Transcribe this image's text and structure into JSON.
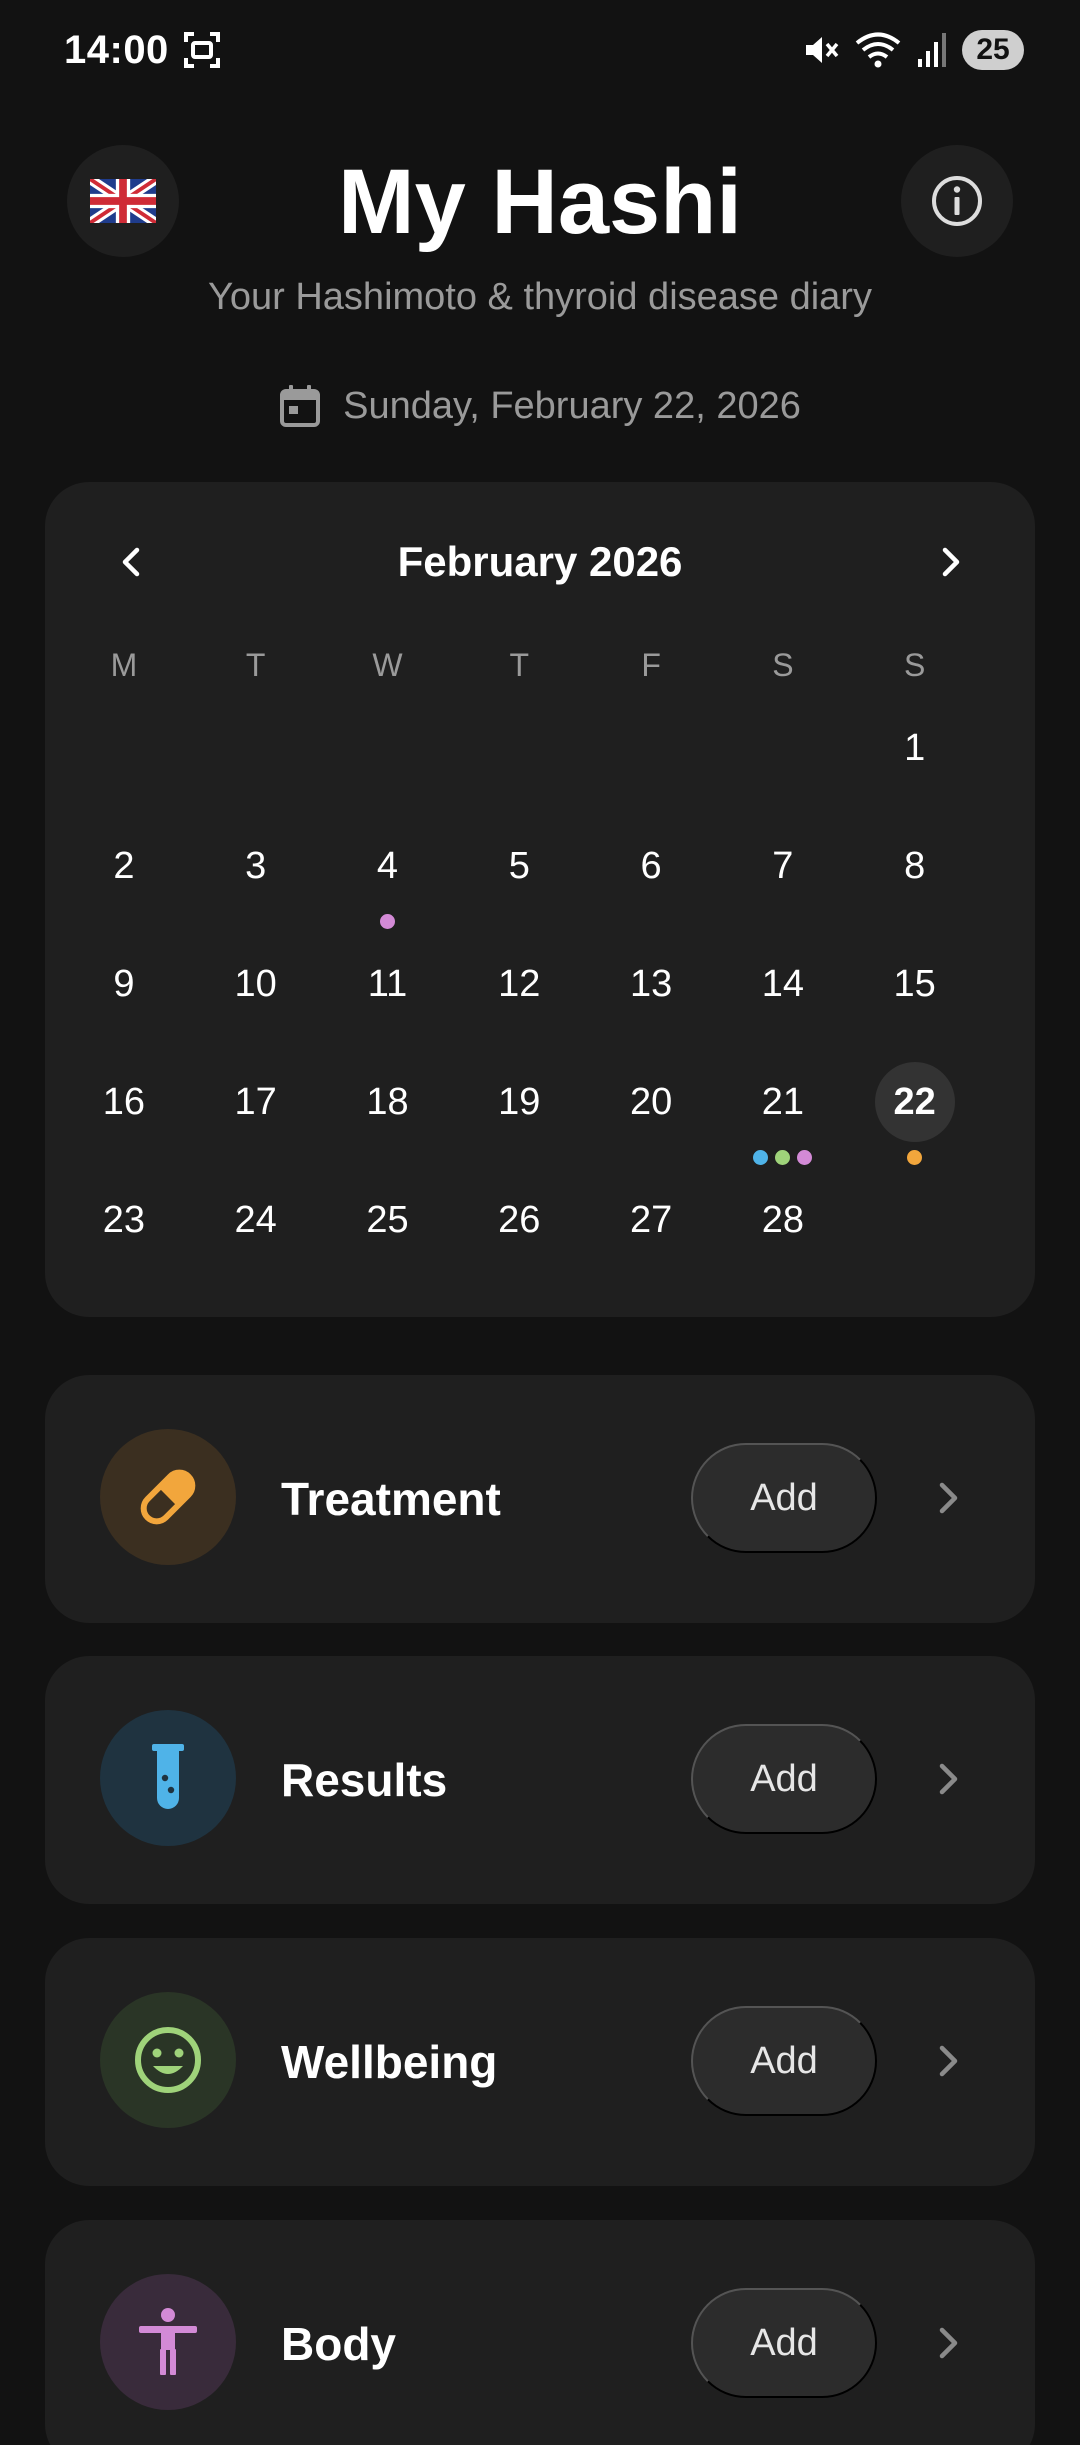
{
  "status_bar": {
    "time": "14:00",
    "battery": "25",
    "icons": [
      "screen-record-icon",
      "mute-icon",
      "wifi-icon",
      "signal-icon"
    ]
  },
  "header": {
    "language_icon": "uk-flag-icon",
    "title": "My Hashi",
    "subtitle": "Your Hashimoto & thyroid disease diary",
    "info_icon": "info-icon",
    "date_icon": "calendar-icon",
    "date": "Sunday, February 22, 2026"
  },
  "calendar": {
    "month_label": "February 2026",
    "weekdays": [
      "M",
      "T",
      "W",
      "T",
      "F",
      "S",
      "S"
    ],
    "weeks": [
      [
        {
          "day": ""
        },
        {
          "day": ""
        },
        {
          "day": ""
        },
        {
          "day": ""
        },
        {
          "day": ""
        },
        {
          "day": ""
        },
        {
          "day": "1"
        }
      ],
      [
        {
          "day": "2"
        },
        {
          "day": "3"
        },
        {
          "day": "4",
          "dots": [
            "#d38ad6"
          ]
        },
        {
          "day": "5"
        },
        {
          "day": "6"
        },
        {
          "day": "7"
        },
        {
          "day": "8"
        }
      ],
      [
        {
          "day": "9"
        },
        {
          "day": "10"
        },
        {
          "day": "11"
        },
        {
          "day": "12"
        },
        {
          "day": "13"
        },
        {
          "day": "14"
        },
        {
          "day": "15"
        }
      ],
      [
        {
          "day": "16"
        },
        {
          "day": "17"
        },
        {
          "day": "18"
        },
        {
          "day": "19"
        },
        {
          "day": "20"
        },
        {
          "day": "21",
          "dots": [
            "#4fb3e8",
            "#9fd37a",
            "#d38ad6"
          ]
        },
        {
          "day": "22",
          "today": true,
          "dots": [
            "#f2a63c"
          ]
        }
      ],
      [
        {
          "day": "23"
        },
        {
          "day": "24"
        },
        {
          "day": "25"
        },
        {
          "day": "26"
        },
        {
          "day": "27"
        },
        {
          "day": "28"
        },
        {
          "day": ""
        }
      ]
    ]
  },
  "categories": [
    {
      "key": "treatment",
      "label": "Treatment",
      "add_label": "Add",
      "icon": "pill-icon",
      "color": "#f2a63c",
      "bg": "#3b2f20"
    },
    {
      "key": "results",
      "label": "Results",
      "add_label": "Add",
      "icon": "test-tube-icon",
      "color": "#4fb3e8",
      "bg": "#1f3340"
    },
    {
      "key": "wellbeing",
      "label": "Wellbeing",
      "add_label": "Add",
      "icon": "smiley-icon",
      "color": "#9fd37a",
      "bg": "#2a3526"
    },
    {
      "key": "body",
      "label": "Body",
      "add_label": "Add",
      "icon": "body-figure-icon",
      "color": "#d38ad6",
      "bg": "#392b3b"
    }
  ]
}
